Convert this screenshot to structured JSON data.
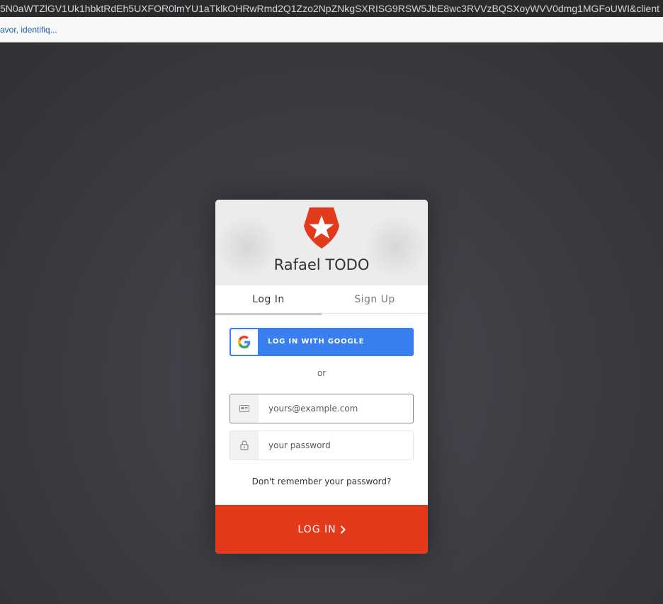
{
  "browser": {
    "url_text": "5N0aWTZlGV1Uk1hbktRdEh5UXFOR0lmYU1aTklkOHRwRmd2Q1Zzo2NpZNkgSXRISG9RSW5JbE8wc3RVVzBQSXoyWVV0dmg1MGFoUWI&client",
    "info_text": "avor, identifiq..."
  },
  "brand": {
    "title": "Rafael TODO",
    "accent_color": "#e33a1c",
    "logo_icon": "shield-star-icon"
  },
  "tabs": [
    {
      "label": "Log In",
      "active": true
    },
    {
      "label": "Sign Up",
      "active": false
    }
  ],
  "social": {
    "google_label": "LOG IN WITH GOOGLE",
    "google_color": "#3a7ff0",
    "icon": "google-icon"
  },
  "separator": "or",
  "form": {
    "email": {
      "placeholder": "yours@example.com",
      "value": "",
      "icon": "id-card-icon"
    },
    "password": {
      "placeholder": "your password",
      "value": "",
      "icon": "lock-icon"
    },
    "forgot_label": "Don't remember your password?",
    "submit_label": "LOG IN",
    "submit_icon": "chevron-right-icon"
  }
}
